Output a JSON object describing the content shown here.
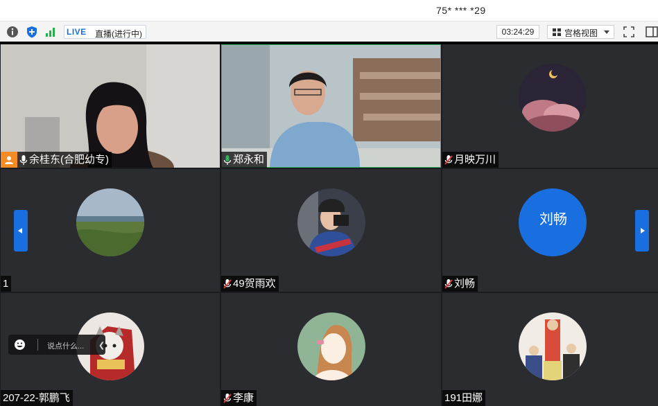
{
  "titlebar": {
    "meeting_id": "75* *** *29"
  },
  "toolbar": {
    "live_tag": "LIVE",
    "live_status": "直播(进行中)",
    "timer": "03:24:29",
    "view_mode": "宫格视图"
  },
  "participants": [
    {
      "name": "余桂东(合肥幼专)",
      "mic": "on",
      "role": "host"
    },
    {
      "name": "郑永和",
      "mic": "speaking"
    },
    {
      "name": "月映万川",
      "mic": "muted"
    },
    {
      "name": "1",
      "mic": "none"
    },
    {
      "name": "49贺雨欢",
      "mic": "muted"
    },
    {
      "name": "刘畅",
      "mic": "muted",
      "avatar_text": "刘畅"
    },
    {
      "name": "207-22-郭鹏飞",
      "mic": "none"
    },
    {
      "name": "李康",
      "mic": "muted"
    },
    {
      "name": "191田娜",
      "mic": "none"
    }
  ],
  "chat": {
    "placeholder": "说点什么..."
  },
  "colors": {
    "accent": "#1a6fe0",
    "host_badge": "#f58b24",
    "speaking": "#2fb35f",
    "tile_bg": "#2b2c30"
  }
}
